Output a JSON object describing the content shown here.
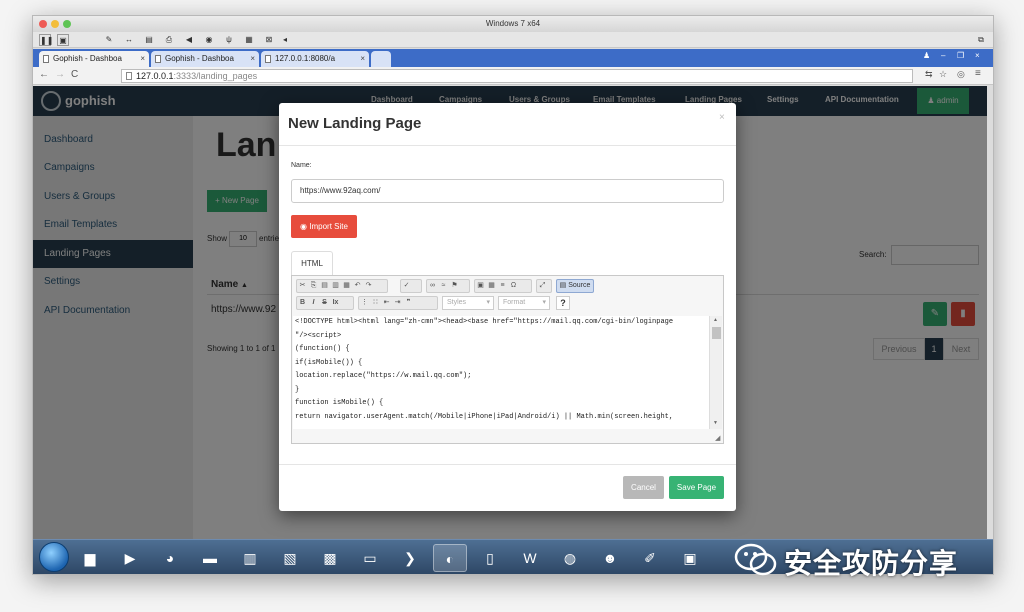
{
  "vm": {
    "title": "Windows 7 x64"
  },
  "browser": {
    "tabs": [
      {
        "label": "Gophish - Dashboa"
      },
      {
        "label": "Gophish - Dashboa"
      },
      {
        "label": "127.0.0.1:8080/a"
      }
    ],
    "url_host": "127.0.0.1",
    "url_rest": ":3333/landing_pages"
  },
  "app": {
    "brand": "gophish",
    "nav": [
      "Dashboard",
      "Campaigns",
      "Users & Groups",
      "Email Templates",
      "Landing Pages",
      "Settings",
      "API Documentation"
    ],
    "admin_label": "admin",
    "sidebar": [
      "Dashboard",
      "Campaigns",
      "Users & Groups",
      "Email Templates",
      "Landing Pages",
      "Settings",
      "API Documentation"
    ],
    "page_title": "Lan",
    "new_page_label": "+ New Page",
    "show_label": "Show",
    "show_value": "10",
    "entries_label": "entrie",
    "search_label": "Search:",
    "col_name": "Name",
    "row_name": "https://www.92",
    "showing": "Showing 1 to 1 of 1",
    "pager": {
      "previous": "Previous",
      "page": "1",
      "next": "Next"
    }
  },
  "modal": {
    "title": "New Landing Page",
    "close": "×",
    "name_label": "Name:",
    "name_value": "https://www.92aq.com/",
    "import_label": "Import Site",
    "tab_html": "HTML",
    "source_label": "Source",
    "styles_label": "Styles",
    "format_label": "Format",
    "help_label": "?",
    "code_lines": [
      "<!DOCTYPE html><html lang=\"zh-cmn\"><head><base href=\"https://mail.qq.com/cgi-bin/loginpage",
      "\"/><script>",
      "(function() {",
      "if(isMobile()) {",
      "location.replace(\"https://w.mail.qq.com\");",
      "}",
      "function isMobile() {",
      "return navigator.userAgent.match(/Mobile|iPhone|iPad|Android/i) || Math.min(screen.height,"
    ],
    "cancel_label": "Cancel",
    "save_label": "Save Page"
  },
  "watermark": {
    "text": "安全攻防分享"
  },
  "colors": {
    "navbar": "#283f50",
    "success": "#37b374",
    "danger": "#e74c3c",
    "chrome_tabbar": "#3d6cc7"
  }
}
